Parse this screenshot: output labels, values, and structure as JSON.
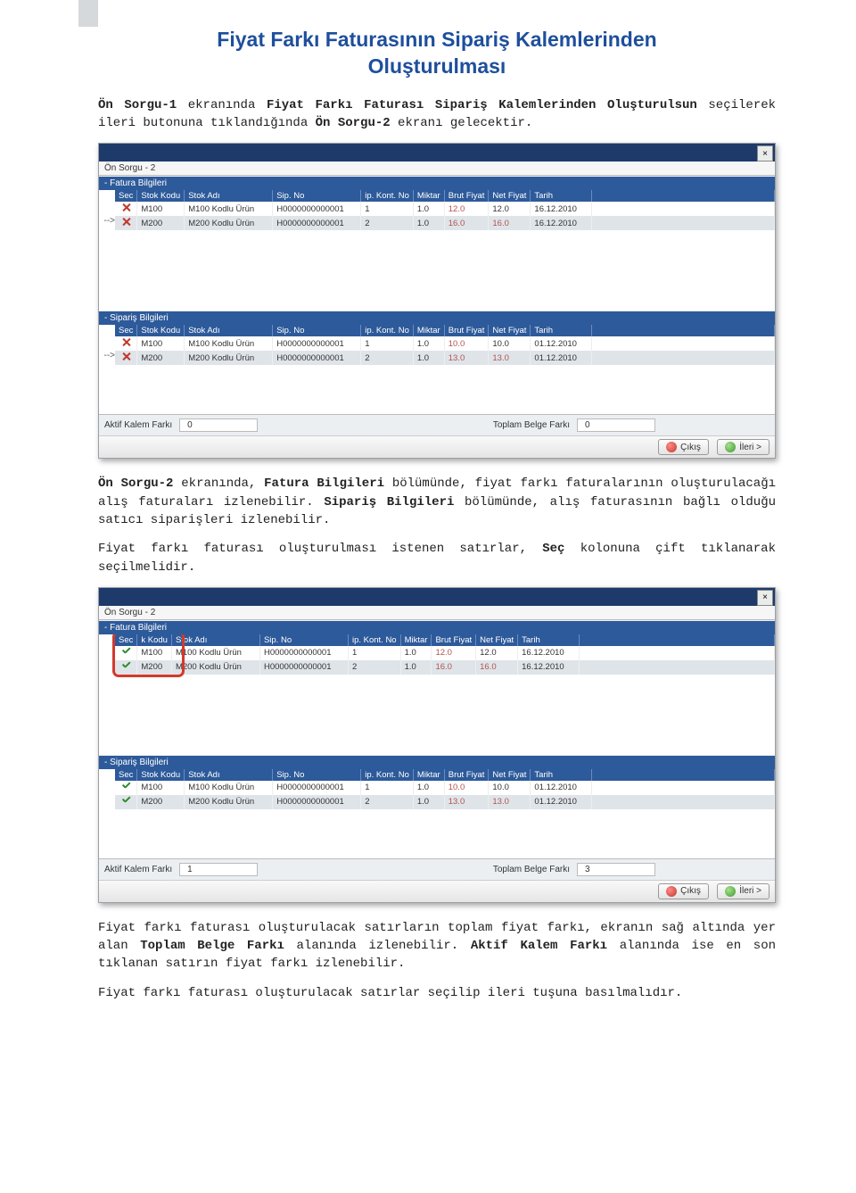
{
  "title_line1": "Fiyat Farkı Faturasının Sipariş Kalemlerinden",
  "title_line2": "Oluşturulması",
  "para1_a": "Ön Sorgu-1",
  "para1_b": " ekranında ",
  "para1_c": "Fiyat Farkı Faturası Sipariş Kalemlerinden Oluşturulsun",
  "para1_d": " seçilerek ileri butonuna tıklandığında ",
  "para1_e": "Ön Sorgu-2",
  "para1_f": " ekranı gelecektir.",
  "win_tab": "Ön Sorgu - 2",
  "sect_fatura": "- Fatura Bilgileri",
  "sect_siparis": "- Sipariş Bilgileri",
  "headers": {
    "sec": "Sec",
    "stokkodu": "Stok Kodu",
    "stokadi": "Stok Adı",
    "sipno": "Sip. No",
    "sipkont": "ip. Kont. No",
    "miktar": "Miktar",
    "brut": "Brut Fiyat",
    "net": "Net Fiyat",
    "tarih": "Tarih"
  },
  "win1": {
    "fatura": [
      {
        "stokkodu": "M100",
        "stokadi": "M100 Kodlu Ürün",
        "sipno": "H0000000000001",
        "kont": "1",
        "miktar": "1.0",
        "brut": "12.0",
        "net": "12.0",
        "tarih": "16.12.2010",
        "sel": false,
        "hl": false
      },
      {
        "stokkodu": "M200",
        "stokadi": "M200 Kodlu Ürün",
        "sipno": "H0000000000001",
        "kont": "2",
        "miktar": "1.0",
        "brut": "16.0",
        "net": "16.0",
        "tarih": "16.12.2010",
        "sel": true,
        "hl": true
      }
    ],
    "siparis": [
      {
        "stokkodu": "M100",
        "stokadi": "M100 Kodlu Ürün",
        "sipno": "H0000000000001",
        "kont": "1",
        "miktar": "1.0",
        "brut": "10.0",
        "net": "10.0",
        "tarih": "01.12.2010",
        "sel": false,
        "hl": false
      },
      {
        "stokkodu": "M200",
        "stokadi": "M200 Kodlu Ürün",
        "sipno": "H0000000000001",
        "kont": "2",
        "miktar": "1.0",
        "brut": "13.0",
        "net": "13.0",
        "tarih": "01.12.2010",
        "sel": true,
        "hl": true
      }
    ],
    "aktif_label": "Aktif Kalem Farkı",
    "aktif_val": "0",
    "toplam_label": "Toplam Belge Farkı",
    "toplam_val": "0"
  },
  "win2": {
    "fatura": [
      {
        "stokkodu": "M100",
        "stokadi": "M100 Kodlu Ürün",
        "sipno": "H0000000000001",
        "kont": "1",
        "miktar": "1.0",
        "brut": "12.0",
        "net": "12.0",
        "tarih": "16.12.2010",
        "ok": true,
        "hl": false
      },
      {
        "stokkodu": "M200",
        "stokadi": "M200 Kodlu Ürün",
        "sipno": "H0000000000001",
        "kont": "2",
        "miktar": "1.0",
        "brut": "16.0",
        "net": "16.0",
        "tarih": "16.12.2010",
        "ok": true,
        "hl": true
      }
    ],
    "siparis": [
      {
        "stokkodu": "M100",
        "stokadi": "M100 Kodlu Ürün",
        "sipno": "H0000000000001",
        "kont": "1",
        "miktar": "1.0",
        "brut": "10.0",
        "net": "10.0",
        "tarih": "01.12.2010",
        "ok": true,
        "hl": false
      },
      {
        "stokkodu": "M200",
        "stokadi": "M200 Kodlu Ürün",
        "sipno": "H0000000000001",
        "kont": "2",
        "miktar": "1.0",
        "brut": "13.0",
        "net": "13.0",
        "tarih": "01.12.2010",
        "ok": true,
        "hl": true
      }
    ],
    "aktif_label": "Aktif Kalem Farkı",
    "aktif_val": "1",
    "toplam_label": "Toplam Belge Farkı",
    "toplam_val": "3"
  },
  "btn_cikis": "Çıkış",
  "btn_ileri": "İleri >",
  "para2_a": "Ön Sorgu-2",
  "para2_b": " ekranında, ",
  "para2_c": "Fatura Bilgileri",
  "para2_d": " bölümünde, fiyat farkı faturalarının oluşturulacağı alış faturaları izlenebilir. ",
  "para2_e": "Sipariş Bilgileri",
  "para2_f": " bölümünde, alış faturasının bağlı olduğu satıcı siparişleri izlenebilir.",
  "para3_a": "Fiyat farkı faturası oluşturulması istenen satırlar, ",
  "para3_b": "Seç",
  "para3_c": " kolonuna çift tıklanarak seçilmelidir.",
  "para4_a": "Fiyat farkı faturası oluşturulacak satırların toplam fiyat farkı, ekranın sağ altında yer alan ",
  "para4_b": "Toplam Belge Farkı",
  "para4_c": " alanında izlenebilir. ",
  "para4_d": "Aktif Kalem Farkı",
  "para4_e": " alanında ise en son tıklanan satırın fiyat farkı izlenebilir.",
  "para5": "Fiyat farkı faturası oluşturulacak satırlar seçilip ileri tuşuna basılmalıdır.",
  "hdr2_kodu": "k Kodu"
}
